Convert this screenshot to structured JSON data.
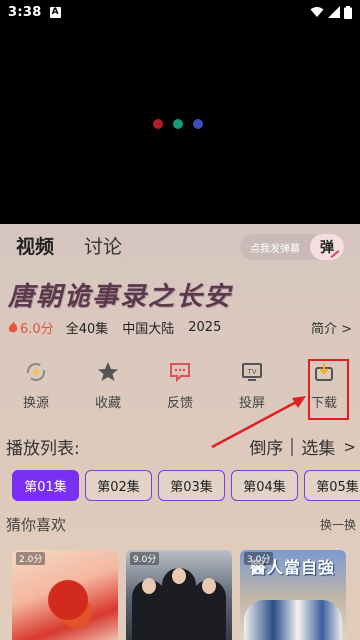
{
  "status_bar": {
    "time": "3:38",
    "notification_glyph": "A"
  },
  "player": {
    "loading_dots": [
      "#b01e2a",
      "#179a76",
      "#3a4fb8"
    ]
  },
  "tabs": [
    {
      "label": "视频",
      "active": true
    },
    {
      "label": "讨论",
      "active": false
    }
  ],
  "danmu": {
    "placeholder": "点我发弹幕",
    "button_label": "弹"
  },
  "show": {
    "title": "唐朝诡事录之长安",
    "score": "6.0分",
    "episodes_total": "全40集",
    "region": "中国大陆",
    "year": "2025",
    "intro_label": "简介 >"
  },
  "actions": [
    {
      "label": "换源",
      "icon": "switch-source-icon"
    },
    {
      "label": "收藏",
      "icon": "star-icon"
    },
    {
      "label": "反馈",
      "icon": "feedback-icon"
    },
    {
      "label": "投屏",
      "icon": "tv-cast-icon"
    },
    {
      "label": "下载",
      "icon": "download-icon"
    }
  ],
  "playlist": {
    "title": "播放列表:",
    "sort_label": "倒序",
    "select_label": "选集",
    "chevron": ">",
    "episodes": [
      {
        "label": "第01集",
        "active": true
      },
      {
        "label": "第02集",
        "active": false
      },
      {
        "label": "第03集",
        "active": false
      },
      {
        "label": "第04集",
        "active": false
      },
      {
        "label": "第05集",
        "active": false
      }
    ]
  },
  "recommend": {
    "title": "猜你喜欢",
    "refresh_label": "换一换",
    "items": [
      {
        "score": "2.0分",
        "banner": ""
      },
      {
        "score": "9.0分",
        "banner": ""
      },
      {
        "score": "3.0分",
        "banner": "醫人當自強"
      }
    ]
  },
  "colors": {
    "accent_purple": "#7b2ff0",
    "highlight_red": "#e02020",
    "score_orange": "#e8543a"
  }
}
